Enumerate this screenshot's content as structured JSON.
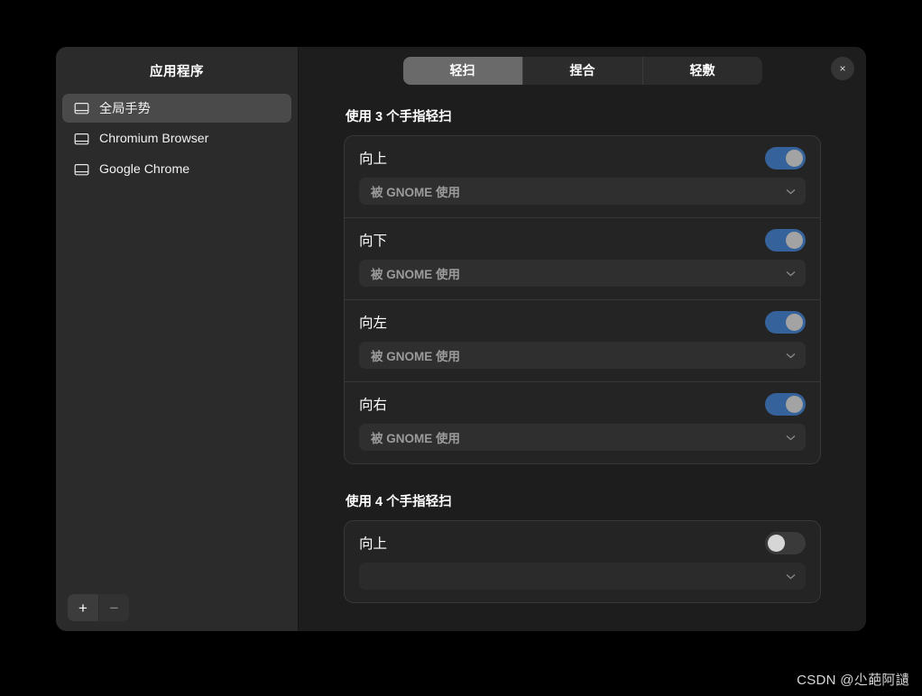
{
  "window": {
    "close_label": "×"
  },
  "sidebar": {
    "title": "应用程序",
    "items": [
      {
        "label": "全局手势",
        "icon": "touchpad-icon",
        "selected": true
      },
      {
        "label": "Chromium Browser",
        "icon": "touchpad-icon",
        "selected": false
      },
      {
        "label": "Google Chrome",
        "icon": "touchpad-icon",
        "selected": false
      }
    ],
    "add_label": "+",
    "remove_label": "−"
  },
  "tabs": [
    {
      "label": "轻扫",
      "active": true
    },
    {
      "label": "捏合",
      "active": false
    },
    {
      "label": "轻敷",
      "active": false
    }
  ],
  "sections": [
    {
      "title": "使用 3 个手指轻扫",
      "rows": [
        {
          "name": "向上",
          "enabled": true,
          "action": "被 GNOME 使用"
        },
        {
          "name": "向下",
          "enabled": true,
          "action": "被 GNOME 使用"
        },
        {
          "name": "向左",
          "enabled": true,
          "action": "被 GNOME 使用"
        },
        {
          "name": "向右",
          "enabled": true,
          "action": "被 GNOME 使用"
        }
      ]
    },
    {
      "title": "使用 4 个手指轻扫",
      "rows": [
        {
          "name": "向上",
          "enabled": false,
          "action": ""
        }
      ]
    }
  ],
  "watermark": "CSDN @尐葩阿讉",
  "colors": {
    "accent": "#35629b",
    "window_bg": "#1d1d1d",
    "sidebar_bg": "#2b2b2b",
    "card_bg": "#242424",
    "page_bg": "#000000"
  }
}
